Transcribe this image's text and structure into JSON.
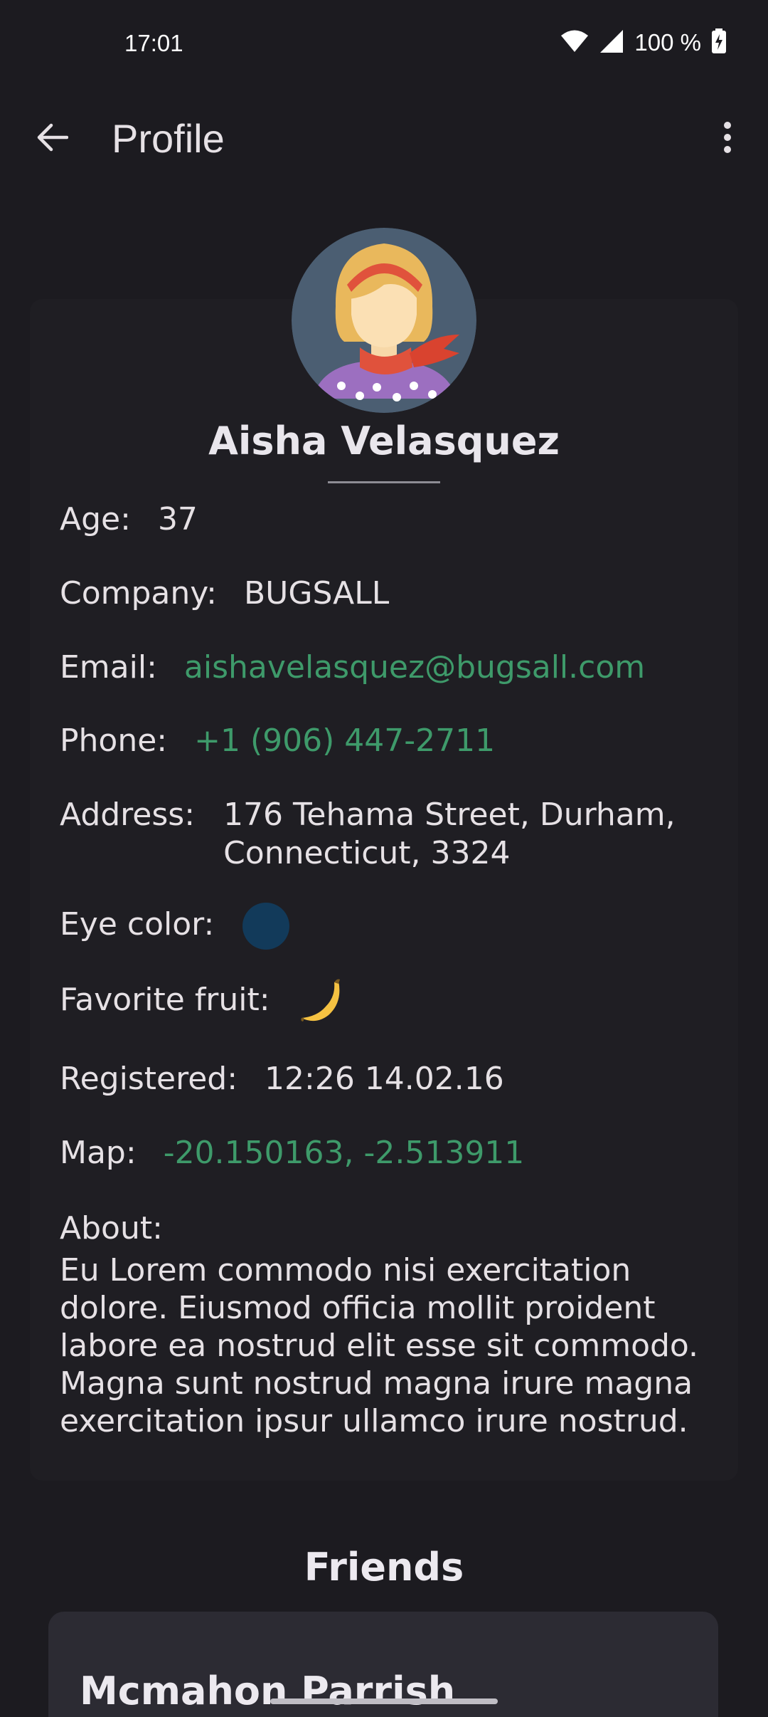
{
  "status_bar": {
    "time": "17:01",
    "battery_text": "100 %",
    "icons": [
      "wifi-icon",
      "signal-icon",
      "battery-charging-icon"
    ]
  },
  "app_bar": {
    "title": "Profile",
    "back_icon": "arrow-left-icon",
    "menu_icon": "more-vert-icon"
  },
  "profile": {
    "name": "Aisha Velasquez",
    "fields": {
      "age_label": "Age:",
      "age": "37",
      "company_label": "Company:",
      "company": "BUGSALL",
      "email_label": "Email:",
      "email": "aishavelasquez@bugsall.com",
      "phone_label": "Phone:",
      "phone": "+1 (906) 447-2711",
      "address_label": "Address:",
      "address_line1": "176 Tehama Street, Durham,",
      "address_line2": "Connecticut, 3324",
      "eye_color_label": "Eye color:",
      "eye_color": "#123a5a",
      "fruit_label": "Favorite fruit:",
      "fruit_icon": "banana-icon",
      "registered_label": "Registered:",
      "registered": "12:26 14.02.16",
      "map_label": "Map:",
      "map": "-20.150163, -2.513911",
      "about_label": "About:",
      "about": "Eu Lorem commodo nisi exercitation dolore. Eiusmod officia mollit proident labore ea nostrud elit esse sit commodo. Magna sunt nostrud magna irure magna exercitation ipsur ullamco irure nostrud."
    }
  },
  "friends": {
    "title": "Friends",
    "items": [
      {
        "name": "Mcmahon Parrish"
      }
    ]
  },
  "colors": {
    "background": "#1c1b20",
    "card": "#1f1e23",
    "link": "#3e9a6a",
    "friend_card": "#2c2b33"
  }
}
